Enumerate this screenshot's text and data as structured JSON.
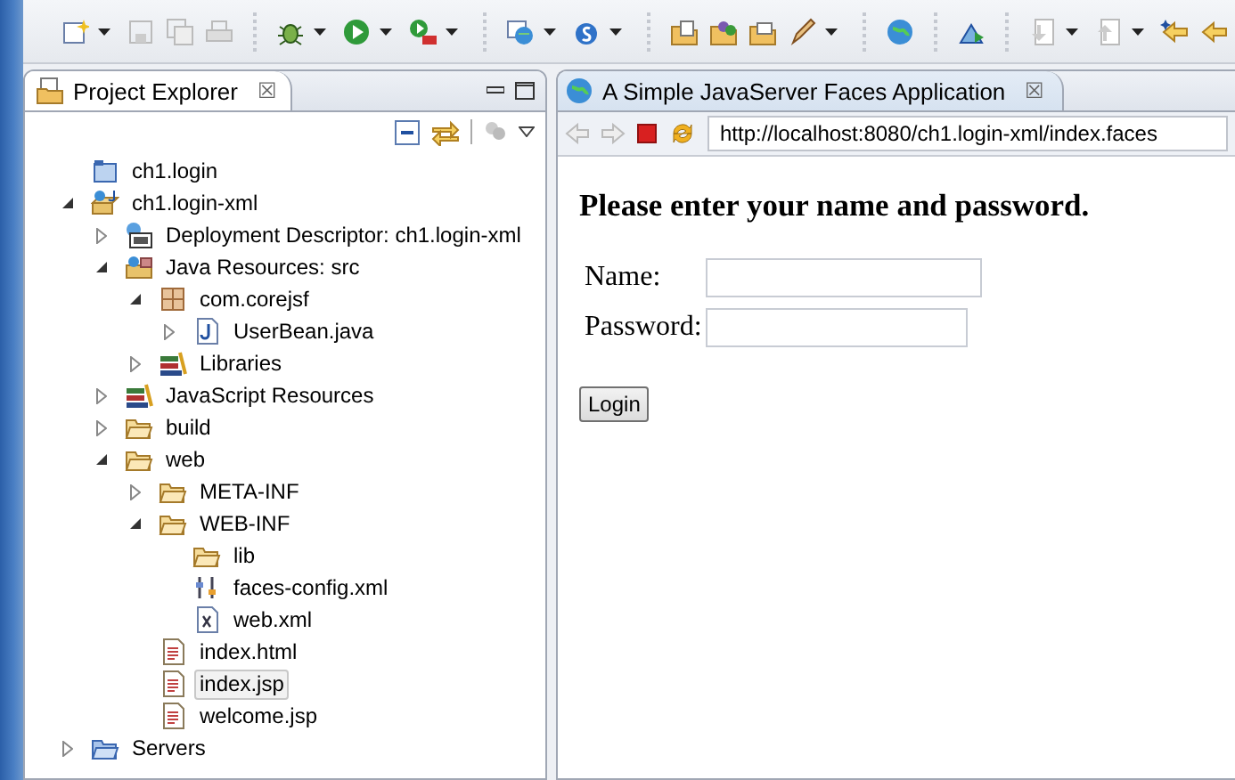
{
  "explorer": {
    "title": "Project Explorer",
    "close": "☒",
    "tree": [
      {
        "label": "ch1.login",
        "kind": "project-closed",
        "selected": false
      },
      {
        "label": "ch1.login-xml",
        "kind": "project",
        "expanded": true,
        "selected": false,
        "children": [
          {
            "label": "Deployment Descriptor: ch1.login-xml",
            "kind": "descriptor",
            "expanded": false,
            "selected": false
          },
          {
            "label": "Java Resources: src",
            "kind": "java-resources",
            "expanded": true,
            "selected": false,
            "children": [
              {
                "label": "com.corejsf",
                "kind": "package",
                "expanded": true,
                "selected": false,
                "children": [
                  {
                    "label": "UserBean.java",
                    "kind": "java",
                    "expanded": false,
                    "selected": false
                  }
                ]
              },
              {
                "label": "Libraries",
                "kind": "library",
                "expanded": false,
                "selected": false
              }
            ]
          },
          {
            "label": "JavaScript Resources",
            "kind": "library",
            "expanded": false,
            "selected": false
          },
          {
            "label": "build",
            "kind": "folder",
            "expanded": false,
            "selected": false
          },
          {
            "label": "web",
            "kind": "folder",
            "expanded": true,
            "selected": false,
            "children": [
              {
                "label": "META-INF",
                "kind": "folder",
                "expanded": false,
                "selected": false
              },
              {
                "label": "WEB-INF",
                "kind": "folder",
                "expanded": true,
                "selected": false,
                "children": [
                  {
                    "label": "lib",
                    "kind": "folder",
                    "selected": false
                  },
                  {
                    "label": "faces-config.xml",
                    "kind": "config",
                    "selected": false
                  },
                  {
                    "label": "web.xml",
                    "kind": "xml",
                    "selected": false
                  }
                ]
              },
              {
                "label": "index.html",
                "kind": "text",
                "selected": false
              },
              {
                "label": "index.jsp",
                "kind": "text",
                "selected": true
              },
              {
                "label": "welcome.jsp",
                "kind": "text",
                "selected": false
              }
            ]
          }
        ]
      },
      {
        "label": "Servers",
        "kind": "servers",
        "expanded": false,
        "selected": false
      }
    ]
  },
  "browser": {
    "tab_title": "A Simple JavaServer Faces Application",
    "close": "☒",
    "url": "http://localhost:8080/ch1.login-xml/index.faces",
    "heading": "Please enter your name and password.",
    "fields": [
      {
        "label": "Name:"
      },
      {
        "label": "Password:"
      }
    ],
    "button": "Login"
  }
}
